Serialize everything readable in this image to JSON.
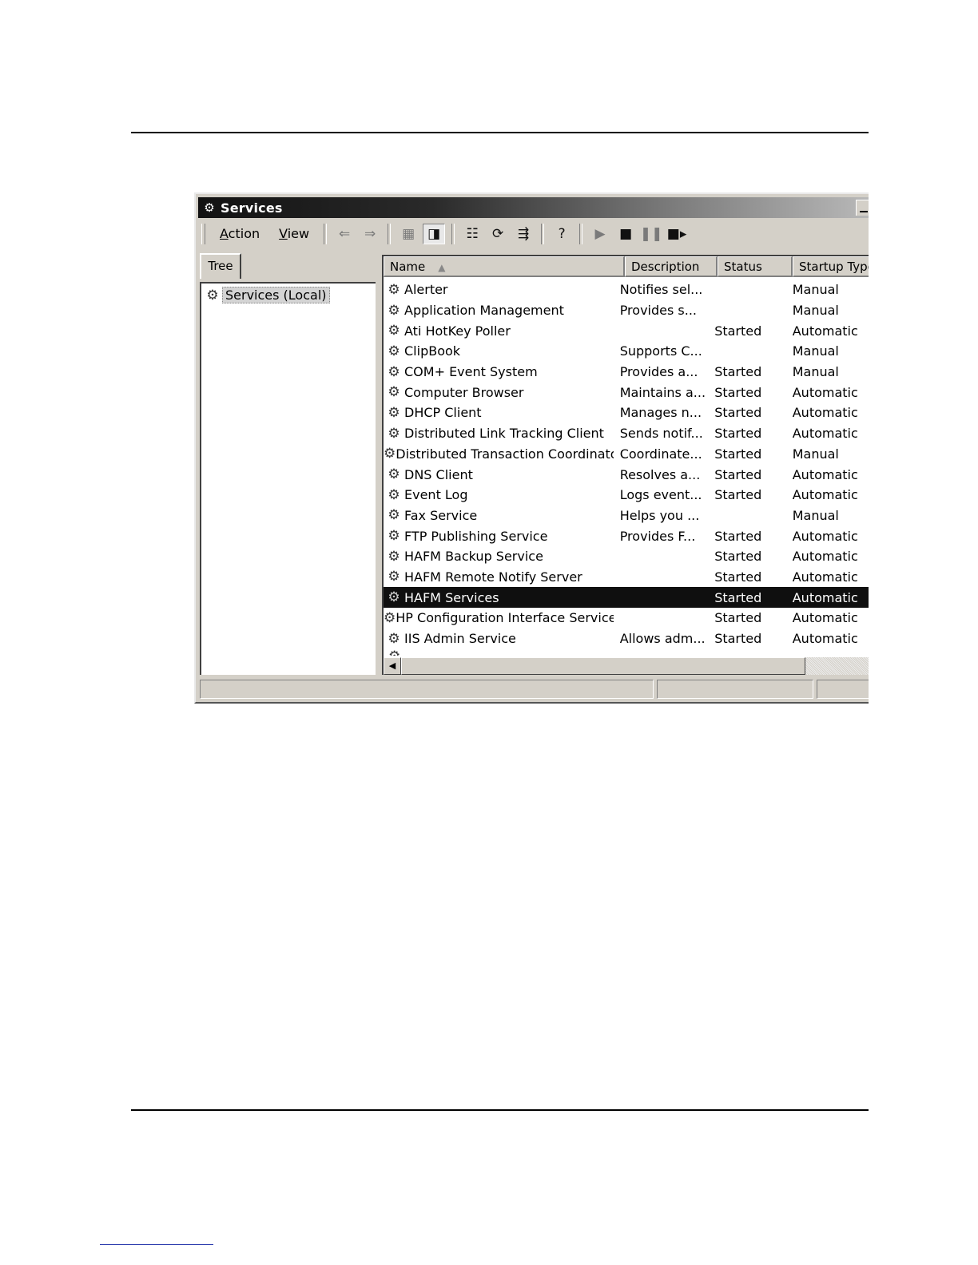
{
  "window": {
    "title": "Services"
  },
  "menu": [
    {
      "accel": "A",
      "rest": "ction"
    },
    {
      "accel": "V",
      "rest": "iew"
    }
  ],
  "toolbar_icons": [
    "back-arrow-icon",
    "forward-arrow-icon",
    "up-folder-icon",
    "show-hide-tree-icon",
    "properties-icon",
    "refresh-icon",
    "export-list-icon",
    "help-icon",
    "start-service-icon",
    "stop-service-icon",
    "pause-service-icon",
    "restart-service-icon"
  ],
  "tree": {
    "tab_label": "Tree",
    "root_label": "Services (Local)"
  },
  "list": {
    "columns": {
      "name": "Name",
      "description": "Description",
      "status": "Status",
      "startup": "Startup Type"
    },
    "rows": [
      {
        "name": "Alerter",
        "description": "Notifies sel...",
        "status": "",
        "startup": "Manual"
      },
      {
        "name": "Application Management",
        "description": "Provides s...",
        "status": "",
        "startup": "Manual"
      },
      {
        "name": "Ati HotKey Poller",
        "description": "",
        "status": "Started",
        "startup": "Automatic"
      },
      {
        "name": "ClipBook",
        "description": "Supports C...",
        "status": "",
        "startup": "Manual"
      },
      {
        "name": "COM+ Event System",
        "description": "Provides a...",
        "status": "Started",
        "startup": "Manual"
      },
      {
        "name": "Computer Browser",
        "description": "Maintains a...",
        "status": "Started",
        "startup": "Automatic"
      },
      {
        "name": "DHCP Client",
        "description": "Manages n...",
        "status": "Started",
        "startup": "Automatic"
      },
      {
        "name": "Distributed Link Tracking Client",
        "description": "Sends notif...",
        "status": "Started",
        "startup": "Automatic"
      },
      {
        "name": "Distributed Transaction Coordinator",
        "description": "Coordinate...",
        "status": "Started",
        "startup": "Manual"
      },
      {
        "name": "DNS Client",
        "description": "Resolves a...",
        "status": "Started",
        "startup": "Automatic"
      },
      {
        "name": "Event Log",
        "description": "Logs event...",
        "status": "Started",
        "startup": "Automatic"
      },
      {
        "name": "Fax Service",
        "description": "Helps you ...",
        "status": "",
        "startup": "Manual"
      },
      {
        "name": "FTP Publishing Service",
        "description": "Provides F...",
        "status": "Started",
        "startup": "Automatic"
      },
      {
        "name": "HAFM Backup Service",
        "description": "",
        "status": "Started",
        "startup": "Automatic"
      },
      {
        "name": "HAFM Remote Notify Server",
        "description": "",
        "status": "Started",
        "startup": "Automatic"
      },
      {
        "name": "HAFM Services",
        "description": "",
        "status": "Started",
        "startup": "Automatic",
        "selected": true
      },
      {
        "name": "HP Configuration Interface Service",
        "description": "",
        "status": "Started",
        "startup": "Automatic"
      },
      {
        "name": "IIS Admin Service",
        "description": "Allows adm...",
        "status": "Started",
        "startup": "Automatic"
      }
    ]
  }
}
